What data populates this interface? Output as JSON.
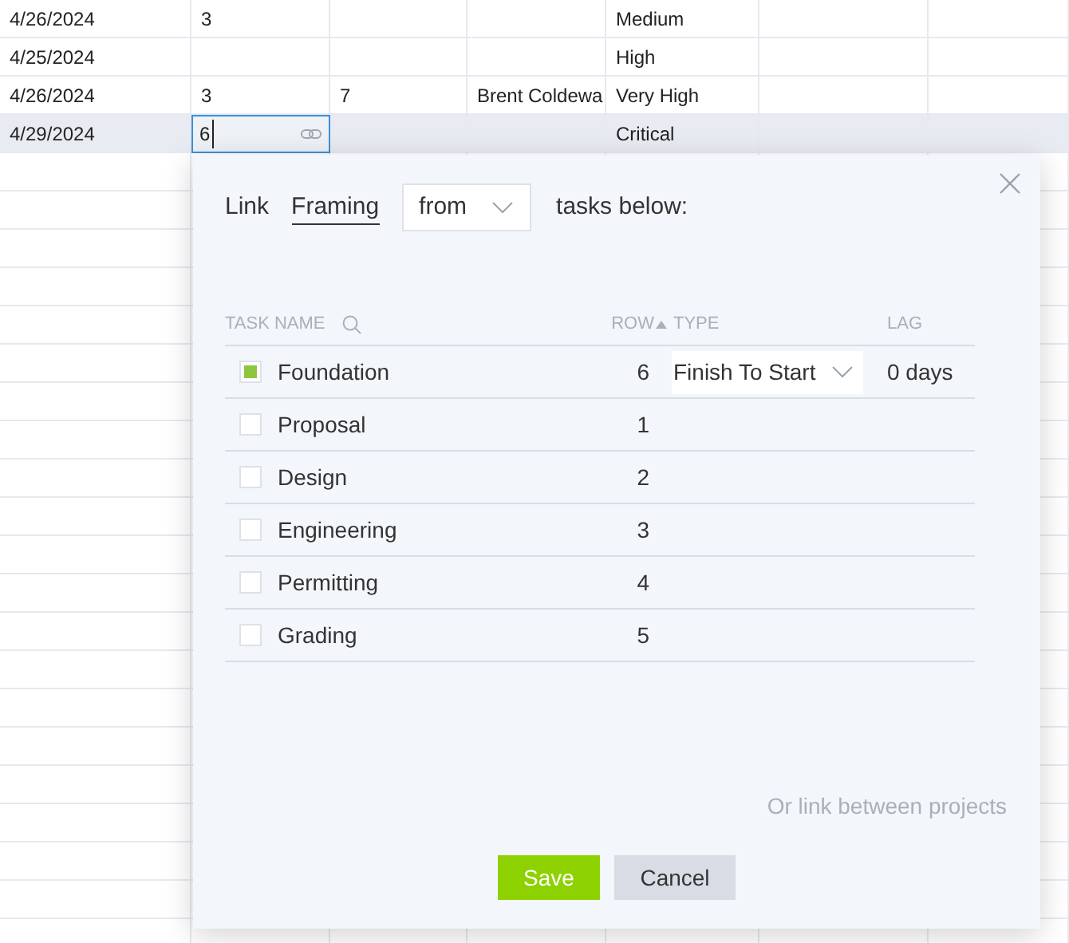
{
  "sheet": {
    "rows": [
      {
        "cells": [
          "4/26/2024",
          "3",
          "",
          "",
          "Medium",
          "",
          ""
        ],
        "selected": false
      },
      {
        "cells": [
          "4/25/2024",
          "",
          "",
          "",
          "High",
          "",
          ""
        ],
        "selected": false
      },
      {
        "cells": [
          "4/26/2024",
          "3",
          "7",
          "Brent Coldewa",
          "Very High",
          "",
          ""
        ],
        "selected": false
      },
      {
        "cells": [
          "4/29/2024",
          {
            "value": "6",
            "editing": true
          },
          "",
          "",
          "Critical",
          "",
          ""
        ],
        "selected": true
      }
    ]
  },
  "dialog": {
    "link_label": "Link",
    "task": "Framing",
    "direction": "from",
    "suffix": "tasks below:",
    "columns": {
      "task_name": "TASK NAME",
      "row": "ROW",
      "type": "TYPE",
      "lag": "LAG"
    },
    "tasks": [
      {
        "name": "Foundation",
        "row": "6",
        "checked": true,
        "type": "Finish To Start",
        "lag": "0 days"
      },
      {
        "name": "Proposal",
        "row": "1",
        "checked": false
      },
      {
        "name": "Design",
        "row": "2",
        "checked": false
      },
      {
        "name": "Engineering",
        "row": "3",
        "checked": false
      },
      {
        "name": "Permitting",
        "row": "4",
        "checked": false
      },
      {
        "name": "Grading",
        "row": "5",
        "checked": false
      }
    ],
    "cross_project_link": "Or link between projects",
    "buttons": {
      "save": "Save",
      "cancel": "Cancel"
    }
  }
}
